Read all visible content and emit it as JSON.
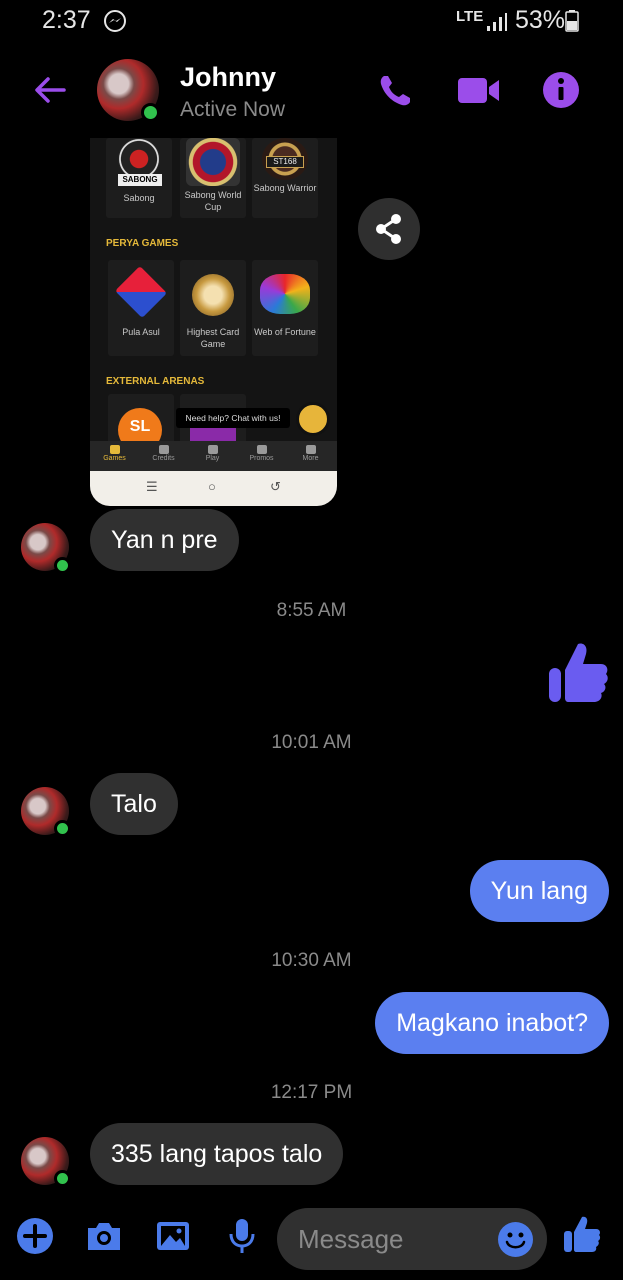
{
  "status_bar": {
    "time": "2:37",
    "network": "LTE",
    "battery": "53%"
  },
  "header": {
    "contact_name": "Johnny",
    "presence": "Active Now",
    "accent_color": "#9b4dea"
  },
  "shared_image": {
    "tiles_row1": [
      "Sabong",
      "Sabong World Cup",
      "Sabong Warrior"
    ],
    "section_perya": "PERYA GAMES",
    "tiles_row2": [
      "Pula Asul",
      "Highest Card Game",
      "Web of Fortune"
    ],
    "section_external": "EXTERNAL ARENAS",
    "help_text": "Need help? Chat with us!",
    "tabs": [
      "Games",
      "Credits",
      "Play",
      "Promos",
      "More"
    ],
    "logo_sabong": "SABONG",
    "logo_warrior": "ST168",
    "logo_arena": "SL"
  },
  "messages": [
    {
      "side": "in",
      "text": "Yan n pre"
    },
    {
      "timestamp": "8:55 AM"
    },
    {
      "side": "out",
      "type": "thumbs-up"
    },
    {
      "timestamp": "10:01 AM"
    },
    {
      "side": "in",
      "text": "Talo"
    },
    {
      "side": "out",
      "text": "Yun lang"
    },
    {
      "timestamp": "10:30 AM"
    },
    {
      "side": "out",
      "text": "Magkano inabot?"
    },
    {
      "timestamp": "12:17 PM"
    },
    {
      "side": "in",
      "text": "335 lang tapos talo"
    }
  ],
  "composer": {
    "placeholder": "Message"
  },
  "colors": {
    "outgoing_bubble": "#5b7ff0",
    "incoming_bubble": "#303030",
    "online": "#31c24d",
    "composer_icons": "#4b7bea"
  }
}
